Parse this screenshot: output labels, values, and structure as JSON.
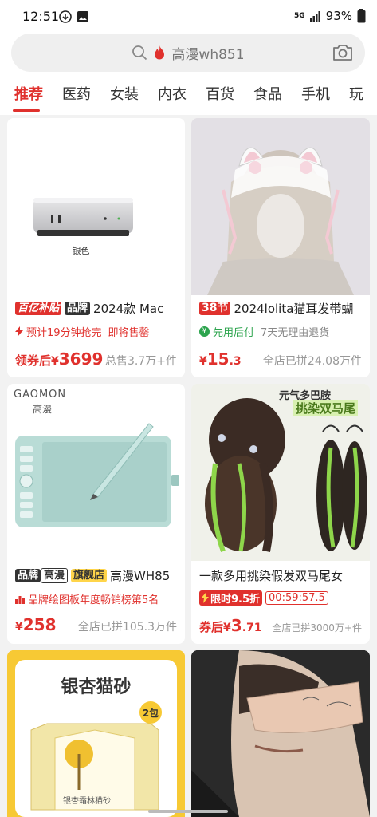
{
  "status": {
    "time": "12:51",
    "network": "5G",
    "battery": "93%"
  },
  "search": {
    "text": "高漫wh851"
  },
  "tabs": [
    "推荐",
    "医药",
    "女装",
    "内衣",
    "百货",
    "食品",
    "手机",
    "玩"
  ],
  "products": [
    {
      "image_caption": "银色",
      "badge_brand": "百亿补贴",
      "badge_type": "品牌",
      "title": "2024款 Mac",
      "sub_icon": "lightning-icon",
      "sub_text": "预计19分钟抢完",
      "sub_text2": "即将售罄",
      "price_prefix": "领券后",
      "currency": "¥",
      "price_int": "3699",
      "price_dec": "",
      "sold": "总售3.7万+件"
    },
    {
      "badge_event": "38节",
      "title": "2024lolita猫耳发带蝴",
      "sub_badge": "先用后付",
      "sub_text": "7天无理由退货",
      "price_prefix": "",
      "currency": "¥",
      "price_int": "15",
      "price_dec": ".3",
      "sold": "全店已拼24.08万件"
    },
    {
      "brand_logo": "GAOMON",
      "brand_cn": "高漫",
      "badge_type": "品牌",
      "badge_brand": "高漫",
      "badge_store": "旗舰店",
      "title": "高漫WH85",
      "sub_text": "品牌绘图板年度畅销榜第5名",
      "price_prefix": "",
      "currency": "¥",
      "price_int": "258",
      "price_dec": "",
      "sold": "全店已拼105.3万件"
    },
    {
      "image_line1": "元气多巴胺",
      "image_line2": "挑染双马尾",
      "title": "一款多用挑染假发双马尾女",
      "limit_label": "限时9.5折",
      "timer": "00:59:57.5",
      "price_prefix": "券后",
      "currency": "¥",
      "price_int": "3",
      "price_dec": ".71",
      "sold": "全店已拼3000万+件"
    },
    {
      "image_title": "银杏猫砂",
      "image_badge": "2包",
      "package_text": "银杏霜林猫砂"
    },
    {}
  ],
  "colors": {
    "accent": "#e0312d",
    "tag_dark": "#333333",
    "tag_yellow": "#ffd54a"
  }
}
